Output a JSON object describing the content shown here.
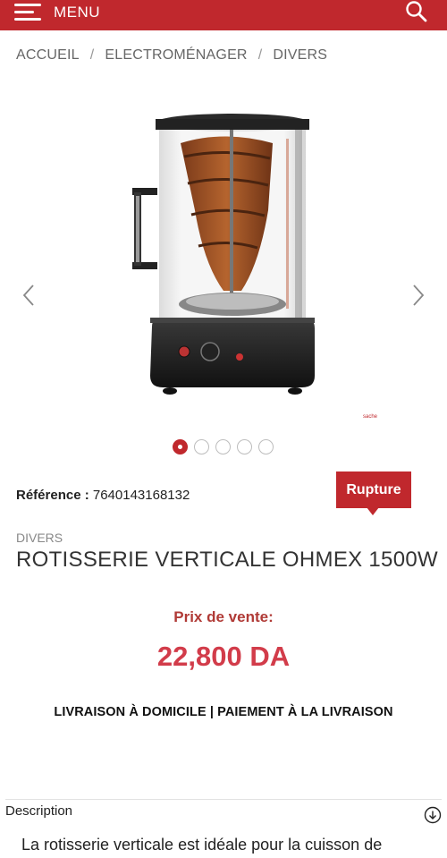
{
  "header": {
    "menu_label": "MENU",
    "brand_color": "#c0282d"
  },
  "breadcrumb": {
    "items": [
      "ACCUEIL",
      "ELECTROMÉNAGER",
      "DIVERS"
    ],
    "separator": "/"
  },
  "gallery": {
    "image_semantic": "vertical-rotisserie-with-kebab",
    "small_mark": "sache",
    "dots_count": 5,
    "active_dot": 1
  },
  "product": {
    "reference_label": "Référence :",
    "reference_value": "7640143168132",
    "stock_badge": "Rupture",
    "category": "DIVERS",
    "title": "ROTISSERIE VERTICALE OHMEX 1500W",
    "price_label": "Prix de vente:",
    "price": "22,800 DA",
    "delivery_info": "LIVRAISON À DOMICILE | PAIEMENT À LA LIVRAISON"
  },
  "description": {
    "header": "Description",
    "text": "La rotisserie verticale est idéale pour la cuisson de"
  }
}
